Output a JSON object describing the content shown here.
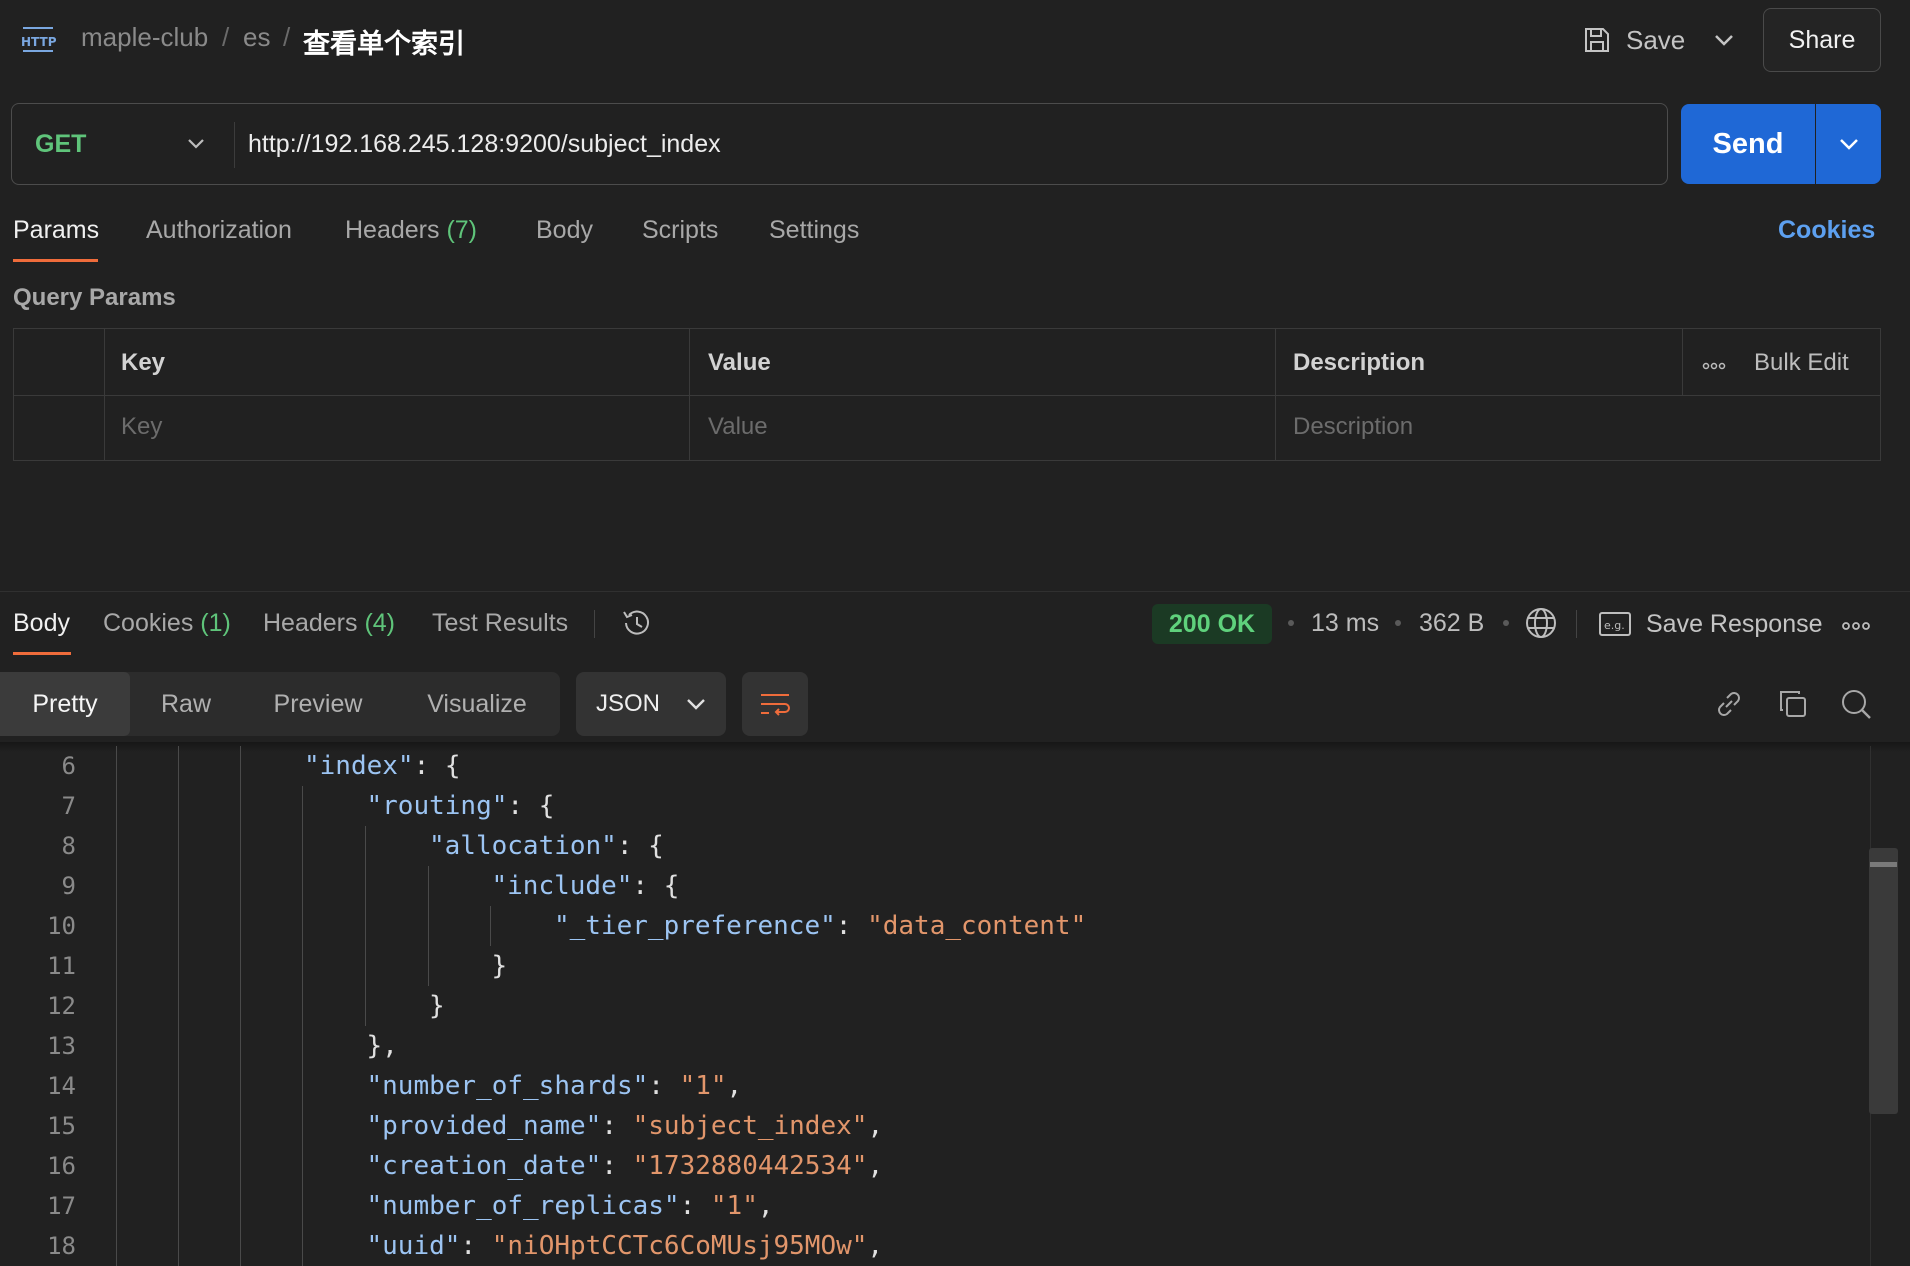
{
  "header": {
    "breadcrumb": [
      "maple-club",
      "es"
    ],
    "separator": "/",
    "current": "查看单个索引",
    "save_label": "Save",
    "share_label": "Share",
    "icon": "http-icon"
  },
  "request": {
    "method": "GET",
    "url": "http://192.168.245.128:9200/subject_index",
    "send_label": "Send"
  },
  "request_tabs": [
    {
      "label": "Params",
      "count": "",
      "active": true
    },
    {
      "label": "Authorization",
      "count": ""
    },
    {
      "label": "Headers",
      "count": "(7)"
    },
    {
      "label": "Body",
      "count": ""
    },
    {
      "label": "Scripts",
      "count": ""
    },
    {
      "label": "Settings",
      "count": ""
    }
  ],
  "cookies_link": "Cookies",
  "query_params": {
    "title": "Query Params",
    "columns": [
      "Key",
      "Value",
      "Description"
    ],
    "bulk_edit": "Bulk Edit",
    "placeholders": {
      "key": "Key",
      "value": "Value",
      "description": "Description"
    }
  },
  "response": {
    "tabs": [
      {
        "label": "Body",
        "count": "",
        "active": true
      },
      {
        "label": "Cookies",
        "count": "(1)"
      },
      {
        "label": "Headers",
        "count": "(4)"
      },
      {
        "label": "Test Results",
        "count": ""
      }
    ],
    "status": "200 OK",
    "time": "13 ms",
    "size": "362 B",
    "save_response": "Save Response",
    "view_modes": [
      "Pretty",
      "Raw",
      "Preview",
      "Visualize"
    ],
    "active_view": "Pretty",
    "format": "JSON",
    "status_color": "#5fd17c"
  },
  "code_lines": [
    {
      "n": "6",
      "indent": 4,
      "parts": [
        [
          "k",
          "\"index\""
        ],
        [
          "p",
          ": {"
        ]
      ]
    },
    {
      "n": "7",
      "indent": 5,
      "parts": [
        [
          "k",
          "\"routing\""
        ],
        [
          "p",
          ": {"
        ]
      ]
    },
    {
      "n": "8",
      "indent": 6,
      "parts": [
        [
          "k",
          "\"allocation\""
        ],
        [
          "p",
          ": {"
        ]
      ]
    },
    {
      "n": "9",
      "indent": 7,
      "parts": [
        [
          "k",
          "\"include\""
        ],
        [
          "p",
          ": {"
        ]
      ]
    },
    {
      "n": "10",
      "indent": 8,
      "parts": [
        [
          "k",
          "\"_tier_preference\""
        ],
        [
          "p",
          ": "
        ],
        [
          "s",
          "\"data_content\""
        ]
      ]
    },
    {
      "n": "11",
      "indent": 7,
      "parts": [
        [
          "p",
          "}"
        ]
      ]
    },
    {
      "n": "12",
      "indent": 6,
      "parts": [
        [
          "p",
          "}"
        ]
      ]
    },
    {
      "n": "13",
      "indent": 5,
      "parts": [
        [
          "p",
          "},"
        ]
      ]
    },
    {
      "n": "14",
      "indent": 5,
      "parts": [
        [
          "k",
          "\"number_of_shards\""
        ],
        [
          "p",
          ": "
        ],
        [
          "s",
          "\"1\""
        ],
        [
          "p",
          ","
        ]
      ]
    },
    {
      "n": "15",
      "indent": 5,
      "parts": [
        [
          "k",
          "\"provided_name\""
        ],
        [
          "p",
          ": "
        ],
        [
          "s",
          "\"subject_index\""
        ],
        [
          "p",
          ","
        ]
      ]
    },
    {
      "n": "16",
      "indent": 5,
      "parts": [
        [
          "k",
          "\"creation_date\""
        ],
        [
          "p",
          ": "
        ],
        [
          "s",
          "\"1732880442534\""
        ],
        [
          "p",
          ","
        ]
      ]
    },
    {
      "n": "17",
      "indent": 5,
      "parts": [
        [
          "k",
          "\"number_of_replicas\""
        ],
        [
          "p",
          ": "
        ],
        [
          "s",
          "\"1\""
        ],
        [
          "p",
          ","
        ]
      ]
    },
    {
      "n": "18",
      "indent": 5,
      "parts": [
        [
          "k",
          "\"uuid\""
        ],
        [
          "p",
          ": "
        ],
        [
          "s",
          "\"niOHptCCTc6CoMUsj95MOw\""
        ],
        [
          "p",
          ","
        ]
      ]
    }
  ],
  "colors": {
    "accent": "#1f68d6",
    "tab_underline": "#ef6c3b",
    "method": "#5fc47a",
    "json_key": "#9cc4f2",
    "json_string": "#e2966b"
  }
}
